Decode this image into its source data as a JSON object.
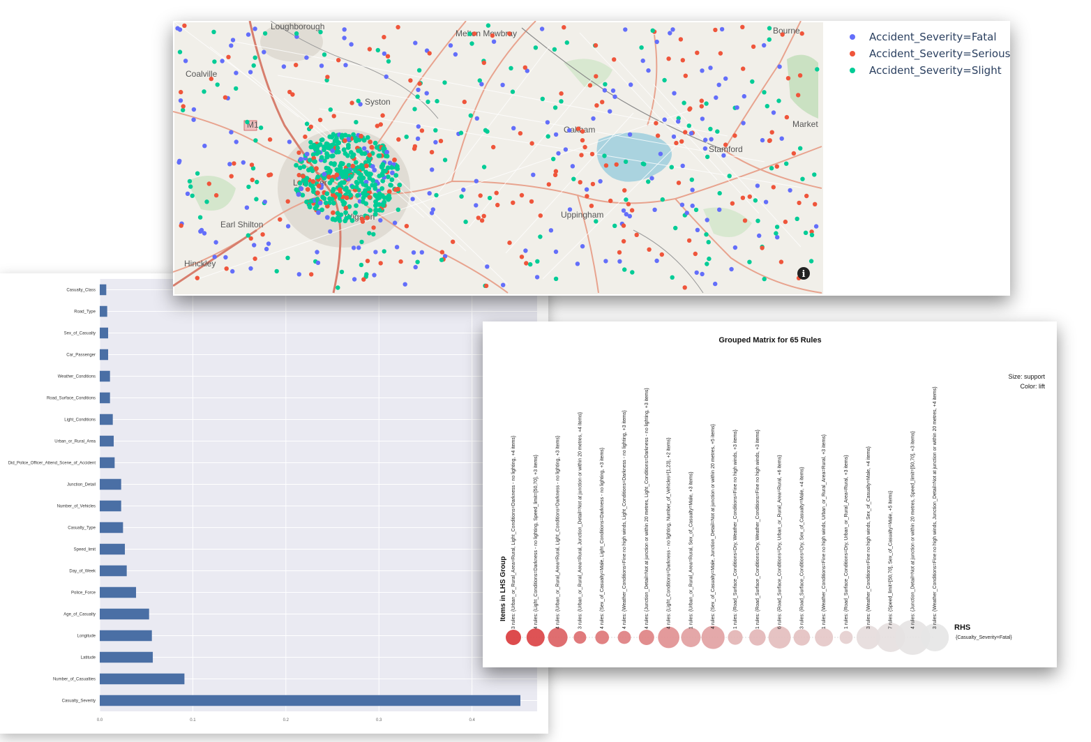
{
  "chart_data": [
    {
      "type": "bar",
      "orientation": "horizontal",
      "categories": [
        "Casualty_Class",
        "Road_Type",
        "Sex_of_Casualty",
        "Car_Passenger",
        "Weather_Conditions",
        "Road_Surface_Conditions",
        "Light_Conditions",
        "Urban_or_Rural_Area",
        "Did_Police_Officer_Attend_Scene_of_Accident",
        "Junction_Detail",
        "Number_of_Vehicles",
        "Casualty_Type",
        "Speed_limit",
        "Day_of_Week",
        "Police_Force",
        "Age_of_Casualty",
        "Longitude",
        "Latitude",
        "Number_of_Casualties",
        "Casualty_Severity"
      ],
      "values": [
        0.007,
        0.008,
        0.009,
        0.009,
        0.011,
        0.011,
        0.014,
        0.015,
        0.016,
        0.023,
        0.023,
        0.025,
        0.027,
        0.029,
        0.039,
        0.053,
        0.056,
        0.057,
        0.091,
        0.452
      ],
      "xticks": [
        "0.0",
        "0.1",
        "0.2",
        "0.3",
        "0.4"
      ],
      "xlim": [
        0,
        0.47
      ],
      "color": "#4a6fa5"
    },
    {
      "type": "scatter",
      "subtype": "map",
      "legend": [
        "Accident_Severity=Fatal",
        "Accident_Severity=Serious",
        "Accident_Severity=Slight"
      ],
      "legend_placement": "top-right",
      "colors": {
        "Fatal": "#636efa",
        "Serious": "#ef553b",
        "Slight": "#00cc96"
      },
      "places": [
        "Loughborough",
        "Melton Mowbray",
        "Bourne",
        "Coalville",
        "Syston",
        "Oakham",
        "Market",
        "Stamford",
        "Leicester",
        "Earl Shilton",
        "Uppingham",
        "Hinckley",
        "Wigston",
        "M1"
      ],
      "info_icon": "i"
    },
    {
      "type": "scatter",
      "subtype": "grouped-matrix",
      "title": "Grouped Matrix for 65 Rules",
      "ylabel": "Items in LHS Group",
      "rhs_label": "RHS",
      "rhs_value": "{Casualty_Severity=Fatal}",
      "size_legend": "Size: support",
      "color_legend": "Color: lift",
      "groups": [
        {
          "label": "3 rules: {Urban_or_Rural_Area=Rural, Light_Conditions=Darkness - no lighting, +4 items}",
          "size": 0.3,
          "lift": 1.0
        },
        {
          "label": "4 rules: {Light_Conditions=Darkness - no lighting, Speed_limit=[50,70], +3 items}",
          "size": 0.4,
          "lift": 0.95
        },
        {
          "label": "4 rules: {Urban_or_Rural_Area=Rural, Light_Conditions=Darkness - no lighting, +3 items}",
          "size": 0.45,
          "lift": 0.78
        },
        {
          "label": "3 rules: {Urban_or_Rural_Area=Rural, Junction_Detail=Not at junction or within 20 metres, +4 items}",
          "size": 0.2,
          "lift": 0.7
        },
        {
          "label": "4 rules: {Sex_of_Casualty=Male, Light_Conditions=Darkness - no lighting, +3 items}",
          "size": 0.24,
          "lift": 0.65
        },
        {
          "label": "4 rules: {Weather_Conditions=Fine no high winds, Light_Conditions=Darkness - no lighting, +3 items}",
          "size": 0.22,
          "lift": 0.6
        },
        {
          "label": "4 rules: {Junction_Detail=Not at junction or within 20 metres, Light_Conditions=Darkness - no lighting, +3 items}",
          "size": 0.3,
          "lift": 0.58
        },
        {
          "label": "4 rules: {Light_Conditions=Darkness - no lighting, Number_of_Vehicles=[1,23), +2 items}",
          "size": 0.52,
          "lift": 0.5
        },
        {
          "label": "1 rules: {Urban_or_Rural_Area=Rural, Sex_of_Casualty=Male, +3 items}",
          "size": 0.45,
          "lift": 0.42
        },
        {
          "label": "4 rules: {Sex_of_Casualty=Male, Junction_Detail=Not at junction or within 20 metres, +5 items}",
          "size": 0.58,
          "lift": 0.4
        },
        {
          "label": "1 rules: {Road_Surface_Conditions=Dry, Weather_Conditions=Fine no high winds, +3 items}",
          "size": 0.28,
          "lift": 0.3
        },
        {
          "label": "1 rules: {Road_Surface_Conditions=Dry, Weather_Conditions=Fine no high winds, +3 items}",
          "size": 0.34,
          "lift": 0.28
        },
        {
          "label": "6 rules: {Road_Surface_Conditions=Dry, Urban_or_Rural_Area=Rural, +6 items}",
          "size": 0.55,
          "lift": 0.24
        },
        {
          "label": "3 rules: {Road_Surface_Conditions=Dry, Sex_of_Casualty=Male, +4 items}",
          "size": 0.34,
          "lift": 0.22
        },
        {
          "label": "1 rules: {Weather_Conditions=Fine no high winds, Urban_or_Rural_Area=Rural, +3 items}",
          "size": 0.4,
          "lift": 0.18
        },
        {
          "label": "1 rules: {Road_Surface_Conditions=Dry, Urban_or_Rural_Area=Rural, +3 items}",
          "size": 0.22,
          "lift": 0.14
        },
        {
          "label": "3 rules: {Weather_Conditions=Fine no high winds, Sex_of_Casualty=Male, +4 items}",
          "size": 0.6,
          "lift": 0.06
        },
        {
          "label": "7 rules: {Speed_limit=[50,70], Sex_of_Casualty=Male, +5 items}",
          "size": 0.8,
          "lift": 0.04
        },
        {
          "label": "4 rules: {Junction_Detail=Not at junction or within 20 metres, Speed_limit=[50,70], +3 items}",
          "size": 1.0,
          "lift": 0.02
        },
        {
          "label": "3 rules: {Weather_Conditions=Fine no high winds, Junction_Detail=Not at junction or within 20 metres, +4 items}",
          "size": 0.75,
          "lift": 0.0
        }
      ]
    }
  ]
}
